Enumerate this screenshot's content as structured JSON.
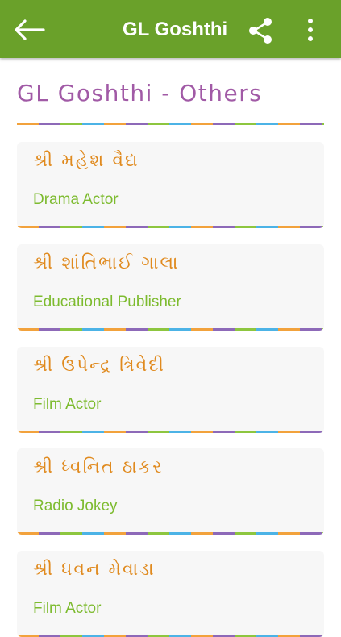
{
  "appbar": {
    "title": "GL Goshthi",
    "icons": {
      "back": "arrow-left-icon",
      "share": "share-icon",
      "more": "more-vertical-icon"
    },
    "color": "#6aa12a"
  },
  "section": {
    "title": "GL Goshthi - Others"
  },
  "colors": {
    "name_text": "#e08a1e",
    "role_text": "#7dbb2f",
    "section_title": "#a15aa6",
    "divider": [
      "#f2a23c",
      "#8d69b8",
      "#8dc63f",
      "#4cb3e6"
    ]
  },
  "people": [
    {
      "name": "શ્રી મહેશ વૈદ્ય",
      "role": "Drama Actor"
    },
    {
      "name": "શ્રી શાંતિભાઈ ગાલા",
      "role": "Educational Publisher"
    },
    {
      "name": "શ્રી ઉપેન્દ્ર ત્રિવેદી",
      "role": "Film Actor"
    },
    {
      "name": "શ્રી ધ્વનિત ઠાકર",
      "role": "Radio Jokey"
    },
    {
      "name": "શ્રી ધવન મેવાડા",
      "role": "Film Actor"
    }
  ]
}
